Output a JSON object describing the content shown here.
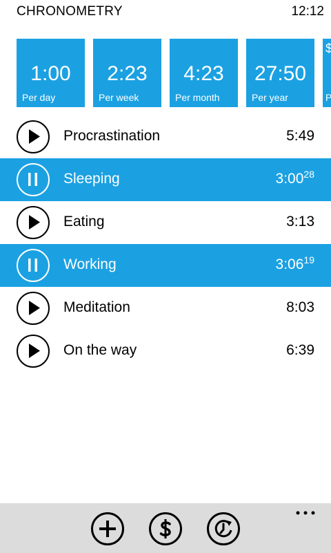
{
  "header": {
    "app_title": "CHRONOMETRY",
    "clock": "12:12"
  },
  "tiles": [
    {
      "value": "1:00",
      "label": "Per day"
    },
    {
      "value": "2:23",
      "label": "Per week"
    },
    {
      "value": "4:23",
      "label": "Per month"
    },
    {
      "value": "27:50",
      "label": "Per year"
    },
    {
      "value": "$",
      "label": "P"
    }
  ],
  "activities": [
    {
      "name": "Procrastination",
      "time": "5:49",
      "seconds": "",
      "state": "stopped",
      "icon": "play-icon"
    },
    {
      "name": "Sleeping",
      "time": "3:00",
      "seconds": "28",
      "state": "running",
      "icon": "pause-icon"
    },
    {
      "name": "Eating",
      "time": "3:13",
      "seconds": "",
      "state": "stopped",
      "icon": "play-icon"
    },
    {
      "name": "Working",
      "time": "3:06",
      "seconds": "19",
      "state": "running",
      "icon": "pause-icon"
    },
    {
      "name": "Meditation",
      "time": "8:03",
      "seconds": "",
      "state": "stopped",
      "icon": "play-icon"
    },
    {
      "name": "On the way",
      "time": "6:39",
      "seconds": "",
      "state": "stopped",
      "icon": "play-icon"
    }
  ],
  "appbar": {
    "buttons": [
      {
        "icon": "add-icon"
      },
      {
        "icon": "dollar-icon"
      },
      {
        "icon": "history-icon"
      }
    ],
    "more_icon": "more-dots-icon"
  },
  "colors": {
    "accent": "#1ba1e2",
    "appbar": "#dcdcdc",
    "background": "#ffffff"
  }
}
